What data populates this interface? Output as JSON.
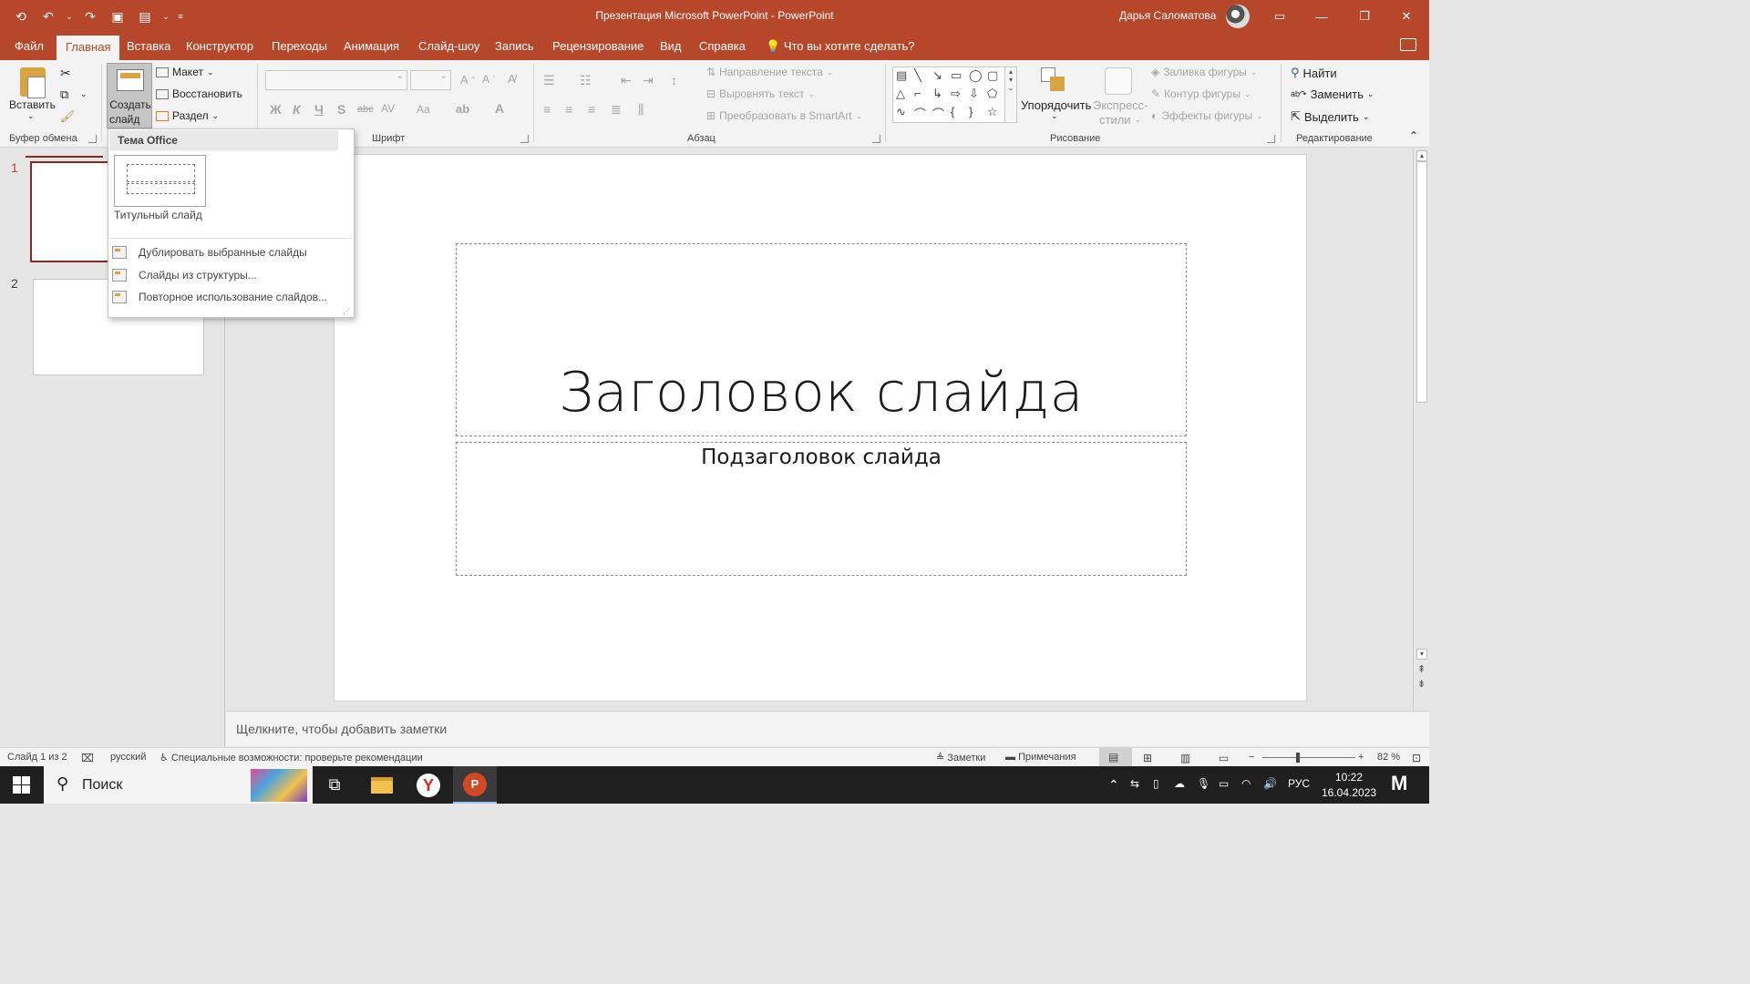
{
  "titlebar": {
    "title": "Презентация Microsoft PowerPoint  -  PowerPoint",
    "user": "Дарья Саломатова"
  },
  "tabs": [
    {
      "label": "Файл"
    },
    {
      "label": "Главная"
    },
    {
      "label": "Вставка"
    },
    {
      "label": "Конструктор"
    },
    {
      "label": "Переходы"
    },
    {
      "label": "Анимация"
    },
    {
      "label": "Слайд-шоу"
    },
    {
      "label": "Запись"
    },
    {
      "label": "Рецензирование"
    },
    {
      "label": "Вид"
    },
    {
      "label": "Справка"
    }
  ],
  "tell_me": "Что вы хотите сделать?",
  "ribbon": {
    "clipboard": {
      "paste": "Вставить",
      "label": "Буфер обмена"
    },
    "slides": {
      "create": "Создать",
      "create2": "слайд",
      "layout": "Макет",
      "reset": "Восстановить",
      "section": "Раздел"
    },
    "font": {
      "label": "Шрифт",
      "bold": "Ж",
      "italic": "К",
      "underline": "Ч",
      "shadow": "S",
      "strike": "abc",
      "spacing": "AV",
      "case": "Aa"
    },
    "paragraph": {
      "label": "Абзац",
      "text_direction": "Направление текста",
      "align_text": "Выровнять текст",
      "smartart": "Преобразовать в SmartArt"
    },
    "drawing": {
      "label": "Рисование",
      "arrange": "Упорядочить",
      "quick_styles": "Экспресс-",
      "quick_styles2": "стили",
      "fill": "Заливка фигуры",
      "outline": "Контур фигуры",
      "effects": "Эффекты фигуры"
    },
    "editing": {
      "label": "Редактирование",
      "find": "Найти",
      "replace": "Заменить",
      "select": "Выделить"
    }
  },
  "dropdown": {
    "header": "Тема Office",
    "layouts": [
      {
        "label": "Титульный слайд"
      }
    ],
    "items": [
      {
        "label": "Дублировать выбранные слайды"
      },
      {
        "label": "Слайды из структуры..."
      },
      {
        "label": "Повторное использование слайдов..."
      }
    ]
  },
  "thumbnails": [
    {
      "num": "1"
    },
    {
      "num": "2"
    }
  ],
  "slide": {
    "title": "Заголовок слайда",
    "subtitle": "Подзаголовок слайда"
  },
  "notes_placeholder": "Щелкните, чтобы добавить заметки",
  "status": {
    "slide_count": "Слайд 1 из 2",
    "language": "русский",
    "accessibility": "Специальные возможности: проверьте рекомендации",
    "notes": "Заметки",
    "comments": "Примечания",
    "zoom": "82 %"
  },
  "taskbar": {
    "search": "Поиск",
    "lang": "РУС",
    "time": "10:22",
    "date": "16.04.2023"
  },
  "colors": {
    "accent": "#b7472a",
    "selection": "#8b2620"
  }
}
